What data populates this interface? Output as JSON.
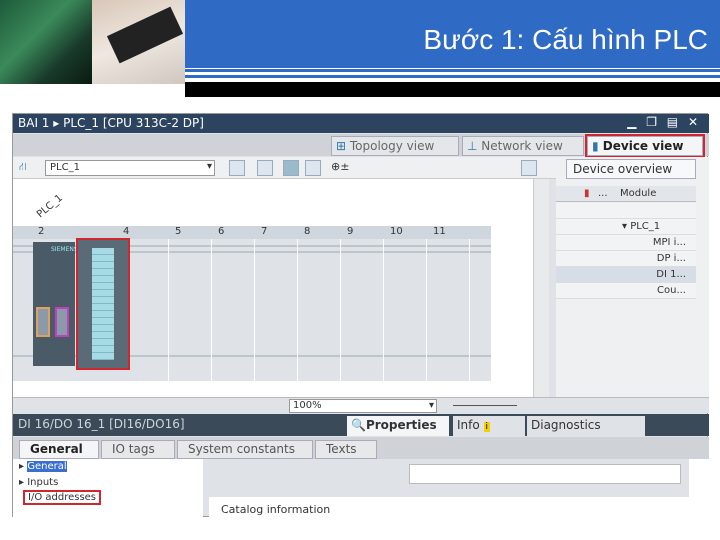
{
  "slide": {
    "title": "Bước 1: Cấu hình PLC",
    "accent": "#2f6bc4"
  },
  "window": {
    "breadcrumb": "BAI 1  ▸  PLC_1 [CPU 313C-2 DP]",
    "controls": "▁ ❐ ▤ ✕"
  },
  "views": {
    "topology": "Topology view",
    "network": "Network view",
    "device": "Device view",
    "active": "Device view"
  },
  "toolbar": {
    "device_select": "PLC_1",
    "zoom": "100%"
  },
  "canvas": {
    "plc_label": "PLC_1",
    "slots": [
      "2",
      "4",
      "5",
      "6",
      "7",
      "8",
      "9",
      "10",
      "11"
    ],
    "cpu_brand": "SIEMENS"
  },
  "overview": {
    "tab": "Device overview",
    "col_dots": "...",
    "col_module": "Module",
    "rows": [
      "▾  PLC_1",
      "MPI i...",
      "DP i...",
      "DI 1...",
      "Cou..."
    ]
  },
  "properties": {
    "title": "DI 16/DO 16_1 [DI16/DO16]",
    "tabs": [
      "Properties",
      "Info",
      "Diagnostics"
    ],
    "active": "Properties"
  },
  "general_tabs": [
    "General",
    "IO tags",
    "System constants",
    "Texts"
  ],
  "nav": [
    "General",
    "Inputs",
    "I/O addresses"
  ],
  "content": {
    "catalog": "Catalog information"
  },
  "highlight_color": "#d0262e"
}
